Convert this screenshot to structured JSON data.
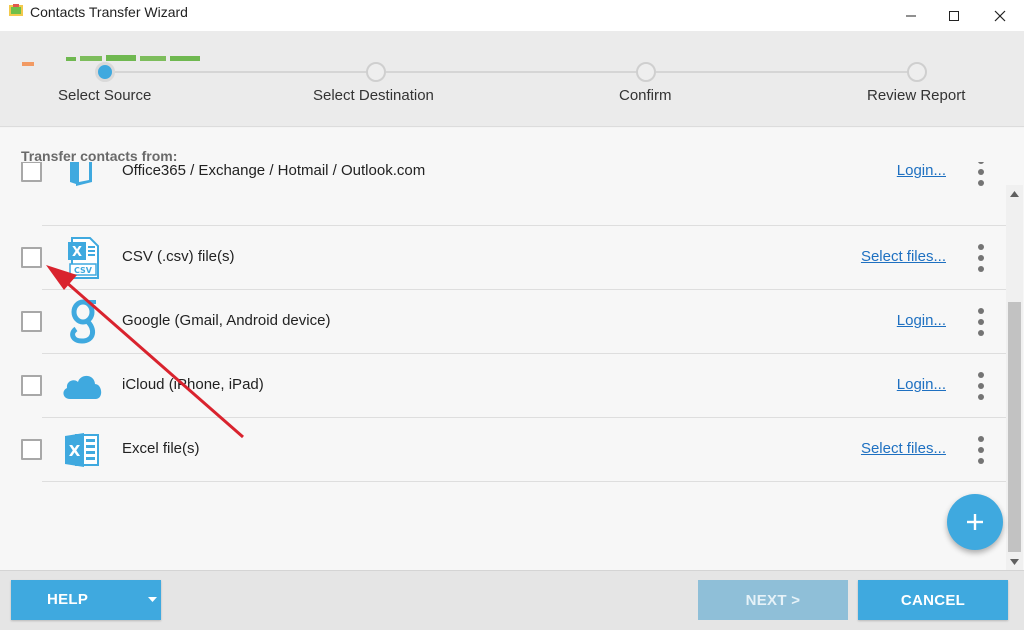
{
  "window": {
    "title": "Contacts Transfer Wizard",
    "controls": [
      "minimize-icon",
      "maximize-icon",
      "close-icon"
    ]
  },
  "steps": [
    {
      "label": "Select Source",
      "active": true
    },
    {
      "label": "Select Destination",
      "active": false
    },
    {
      "label": "Confirm",
      "active": false
    },
    {
      "label": "Review Report",
      "active": false
    }
  ],
  "content": {
    "title": "Transfer contacts from:",
    "sources": [
      {
        "label": "Office365 / Exchange / Hotmail / Outlook.com",
        "action": "Login...",
        "icon": "office365-icon",
        "checked": false
      },
      {
        "label": "CSV (.csv) file(s)",
        "action": "Select files...",
        "icon": "csv-file-icon",
        "checked": false
      },
      {
        "label": "Google (Gmail, Android device)",
        "action": "Login...",
        "icon": "google-icon",
        "checked": false
      },
      {
        "label": "iCloud (iPhone, iPad)",
        "action": "Login...",
        "icon": "icloud-icon",
        "checked": false
      },
      {
        "label": "Excel file(s)",
        "action": "Select files...",
        "icon": "excel-file-icon",
        "checked": false
      }
    ],
    "csv_icon_text": "CSV",
    "add_button_icon": "plus-icon"
  },
  "footer": {
    "help_label": "HELP",
    "next_label": "NEXT >",
    "cancel_label": "CANCEL"
  },
  "colors": {
    "accent": "#3fa9df",
    "link": "#1e70c1",
    "disabled_button": "#8fbfd8",
    "annotation_arrow": "#d9232e",
    "office_orange": "#f29a63"
  }
}
